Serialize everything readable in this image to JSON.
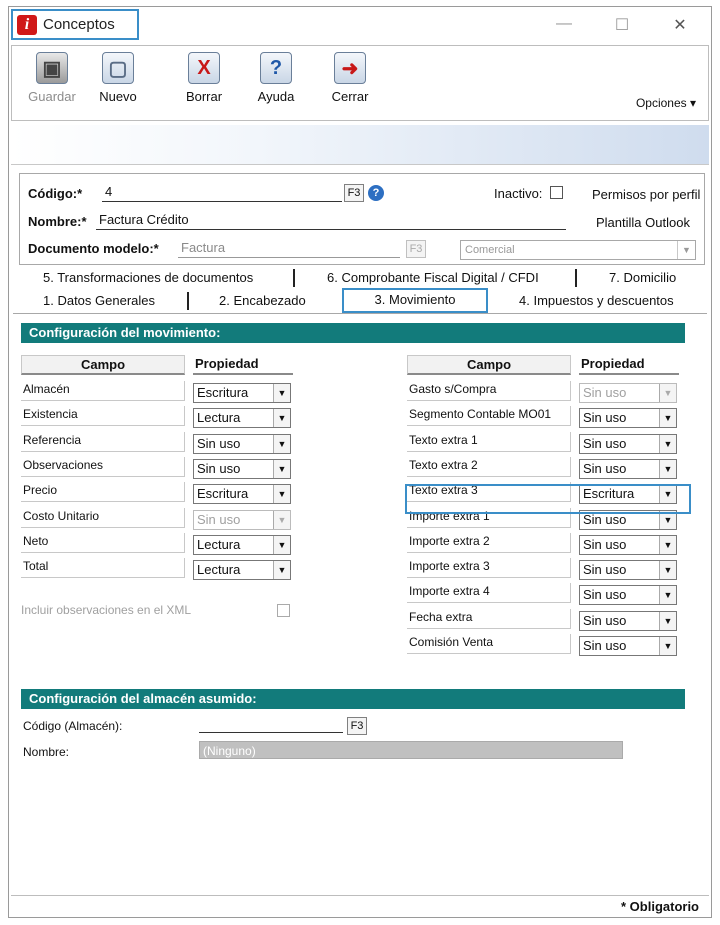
{
  "window": {
    "title": "Conceptos",
    "controls": {
      "minimize": "—",
      "maximize": "☐",
      "close": "✕"
    }
  },
  "toolbar": {
    "buttons": [
      {
        "label": "Guardar",
        "icon": "save-icon",
        "glyph": "▣",
        "disabled": true
      },
      {
        "label": "Nuevo",
        "icon": "new-document-icon",
        "glyph": "▢",
        "disabled": false
      },
      {
        "label": "Borrar",
        "icon": "delete-icon",
        "glyph": "X",
        "disabled": false
      },
      {
        "label": "Ayuda",
        "icon": "help-icon",
        "glyph": "?",
        "disabled": false
      },
      {
        "label": "Cerrar",
        "icon": "close-door-icon",
        "glyph": "➜",
        "disabled": false
      }
    ],
    "options_label": "Opciones ▾"
  },
  "header": {
    "codigo_label": "Código:*",
    "codigo_value": "4",
    "codigo_key": "F3",
    "inactivo_label": "Inactivo:",
    "permisos_label": "Permisos por perfil",
    "nombre_label": "Nombre:*",
    "nombre_value": "Factura Crédito",
    "plantilla_label": "Plantilla Outlook",
    "documento_label": "Documento modelo:*",
    "documento_value": "Factura",
    "documento_key": "F3",
    "comercial_value": "Comercial"
  },
  "tabs": {
    "row1": [
      "5. Transformaciones de documentos",
      "6. Comprobante Fiscal Digital / CFDI",
      "7. Domicilio"
    ],
    "row2": [
      "1. Datos Generales",
      "2. Encabezado",
      "3. Movimiento",
      "4. Impuestos y descuentos"
    ],
    "active": "3. Movimiento"
  },
  "movimiento": {
    "section_title": "Configuración del movimiento:",
    "col_campo": "Campo",
    "col_propiedad": "Propiedad",
    "left_rows": [
      {
        "campo": "Almacén",
        "propiedad": "Escritura",
        "disabled": false
      },
      {
        "campo": "Existencia",
        "propiedad": "Lectura",
        "disabled": false
      },
      {
        "campo": "Referencia",
        "propiedad": "Sin uso",
        "disabled": false
      },
      {
        "campo": "Observaciones",
        "propiedad": "Sin uso",
        "disabled": false
      },
      {
        "campo": "Precio",
        "propiedad": "Escritura",
        "disabled": false
      },
      {
        "campo": "Costo Unitario",
        "propiedad": "Sin uso",
        "disabled": true
      },
      {
        "campo": "Neto",
        "propiedad": "Lectura",
        "disabled": false
      },
      {
        "campo": "Total",
        "propiedad": "Lectura",
        "disabled": false
      }
    ],
    "right_rows": [
      {
        "campo": "Gasto s/Compra",
        "propiedad": "Sin uso",
        "disabled": true
      },
      {
        "campo": "Segmento Contable MO01",
        "propiedad": "Sin uso",
        "disabled": false
      },
      {
        "campo": "Texto extra 1",
        "propiedad": "Sin uso",
        "disabled": false
      },
      {
        "campo": "Texto extra 2",
        "propiedad": "Sin uso",
        "disabled": false
      },
      {
        "campo": "Texto extra 3",
        "propiedad": "Escritura",
        "disabled": false
      },
      {
        "campo": "Importe extra 1",
        "propiedad": "Sin uso",
        "disabled": false
      },
      {
        "campo": "Importe extra 2",
        "propiedad": "Sin uso",
        "disabled": false
      },
      {
        "campo": "Importe extra 3",
        "propiedad": "Sin uso",
        "disabled": false
      },
      {
        "campo": "Importe extra 4",
        "propiedad": "Sin uso",
        "disabled": false
      },
      {
        "campo": "Fecha extra",
        "propiedad": "Sin uso",
        "disabled": false
      },
      {
        "campo": "Comisión Venta",
        "propiedad": "Sin uso",
        "disabled": false
      }
    ],
    "xml_label": "Incluir observaciones en el XML"
  },
  "almacen": {
    "section_title": "Configuración del almacén asumido:",
    "codigo_label": "Código (Almacén):",
    "codigo_value": "",
    "codigo_key": "F3",
    "nombre_label": "Nombre:",
    "nombre_value": "(Ninguno)"
  },
  "status": {
    "obligatorio": "* Obligatorio"
  },
  "colors": {
    "section_header": "#127b7b",
    "highlight_border": "#3a8ec8",
    "app_icon": "#d01818"
  }
}
